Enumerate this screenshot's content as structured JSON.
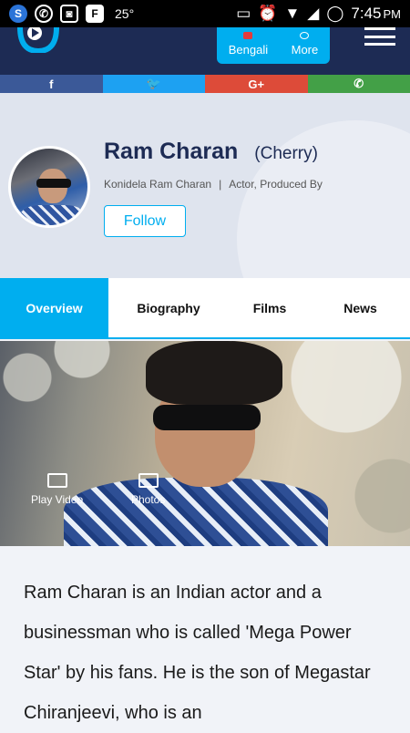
{
  "status_bar": {
    "time": "7:45",
    "ampm": "PM",
    "temperature": "25°",
    "icons": [
      "s-app-icon",
      "whatsapp-icon",
      "camera-icon",
      "flipboard-icon",
      "cast-icon",
      "alarm-icon",
      "wifi-icon",
      "signal-icon",
      "battery-icon"
    ]
  },
  "header": {
    "languages": [
      "Bengali",
      "More"
    ]
  },
  "share": {
    "buttons": [
      "facebook",
      "twitter",
      "google-plus",
      "whatsapp"
    ],
    "colors": [
      "#3b5998",
      "#1da1f2",
      "#dd4b39",
      "#43a047"
    ]
  },
  "profile": {
    "name": "Ram Charan",
    "alias": "(Cherry)",
    "full_name": "Konidela Ram Charan",
    "roles": "Actor, Produced By",
    "follow_label": "Follow"
  },
  "tabs": [
    "Overview",
    "Biography",
    "Films",
    "News"
  ],
  "hero": {
    "play_label": "Play Video",
    "photos_label": "Photos"
  },
  "bio": "Ram Charan is an Indian actor and a businessman who is called 'Mega Power Star' by his fans. He is the son of Megastar Chiranjeevi, who is an",
  "colors": {
    "accent": "#00aeef",
    "navy": "#1d2b54"
  }
}
